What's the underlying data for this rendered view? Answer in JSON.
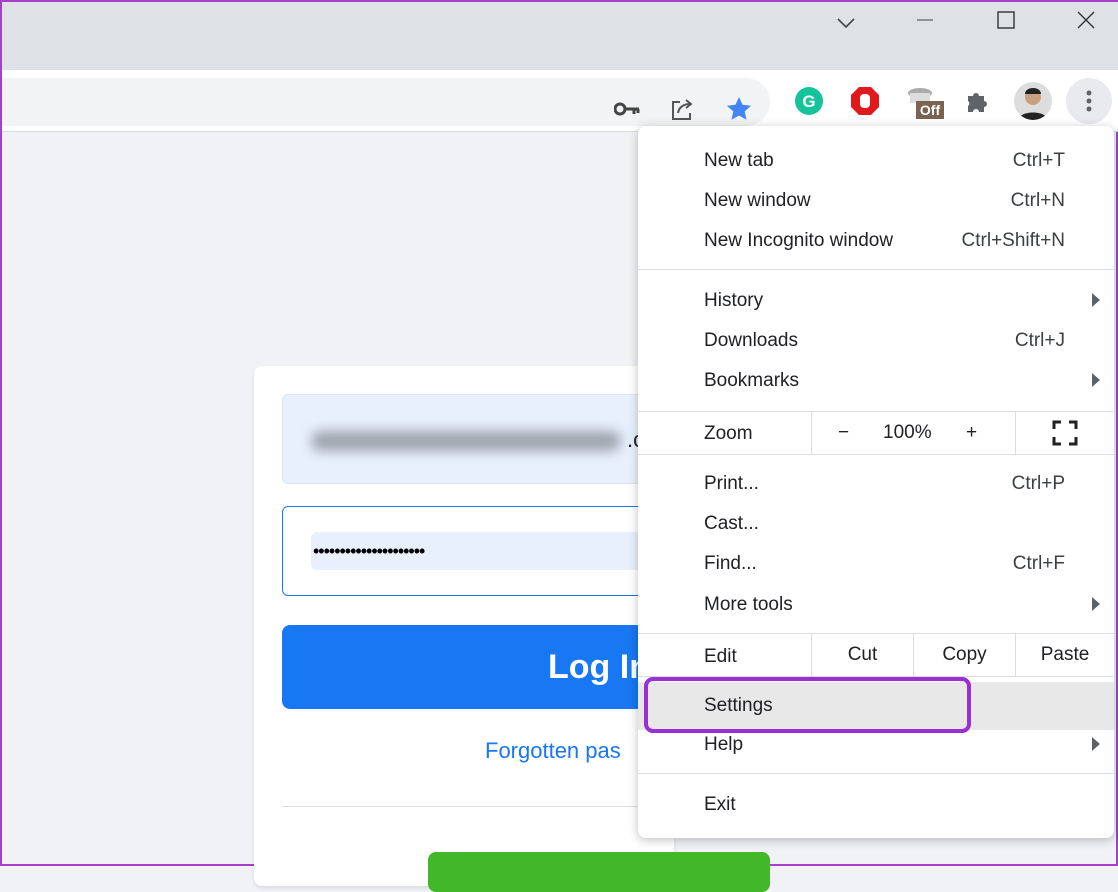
{
  "window": {
    "controls": [
      "chevron-down",
      "minimize",
      "maximize",
      "close"
    ]
  },
  "toolbar": {
    "extension_badge": "Off",
    "avatar": "profile-avatar",
    "colors": {
      "star": "#4285f4",
      "grammarly": "#15c39a",
      "adblock": "#e0191d"
    }
  },
  "page": {
    "email_visible_tail": ".c",
    "password_mask": "•••••••••••••••••••••",
    "login_label": "Log In",
    "forgot_label": "Forgotten pas"
  },
  "menu": {
    "group1": [
      {
        "label": "New tab",
        "shortcut": "Ctrl+T"
      },
      {
        "label": "New window",
        "shortcut": "Ctrl+N"
      },
      {
        "label": "New Incognito window",
        "shortcut": "Ctrl+Shift+N"
      }
    ],
    "group2": [
      {
        "label": "History",
        "shortcut": ""
      },
      {
        "label": "Downloads",
        "shortcut": "Ctrl+J"
      },
      {
        "label": "Bookmarks",
        "shortcut": ""
      }
    ],
    "zoom": {
      "label": "Zoom",
      "minus": "−",
      "value": "100%",
      "plus": "+"
    },
    "group3": [
      {
        "label": "Print...",
        "shortcut": "Ctrl+P"
      },
      {
        "label": "Cast...",
        "shortcut": ""
      },
      {
        "label": "Find...",
        "shortcut": "Ctrl+F"
      },
      {
        "label": "More tools",
        "shortcut": ""
      }
    ],
    "edit": {
      "label": "Edit",
      "cut": "Cut",
      "copy": "Copy",
      "paste": "Paste"
    },
    "group4": [
      {
        "label": "Settings"
      },
      {
        "label": "Help"
      }
    ],
    "exit": "Exit",
    "highlight_color": "#9b2fd6"
  }
}
